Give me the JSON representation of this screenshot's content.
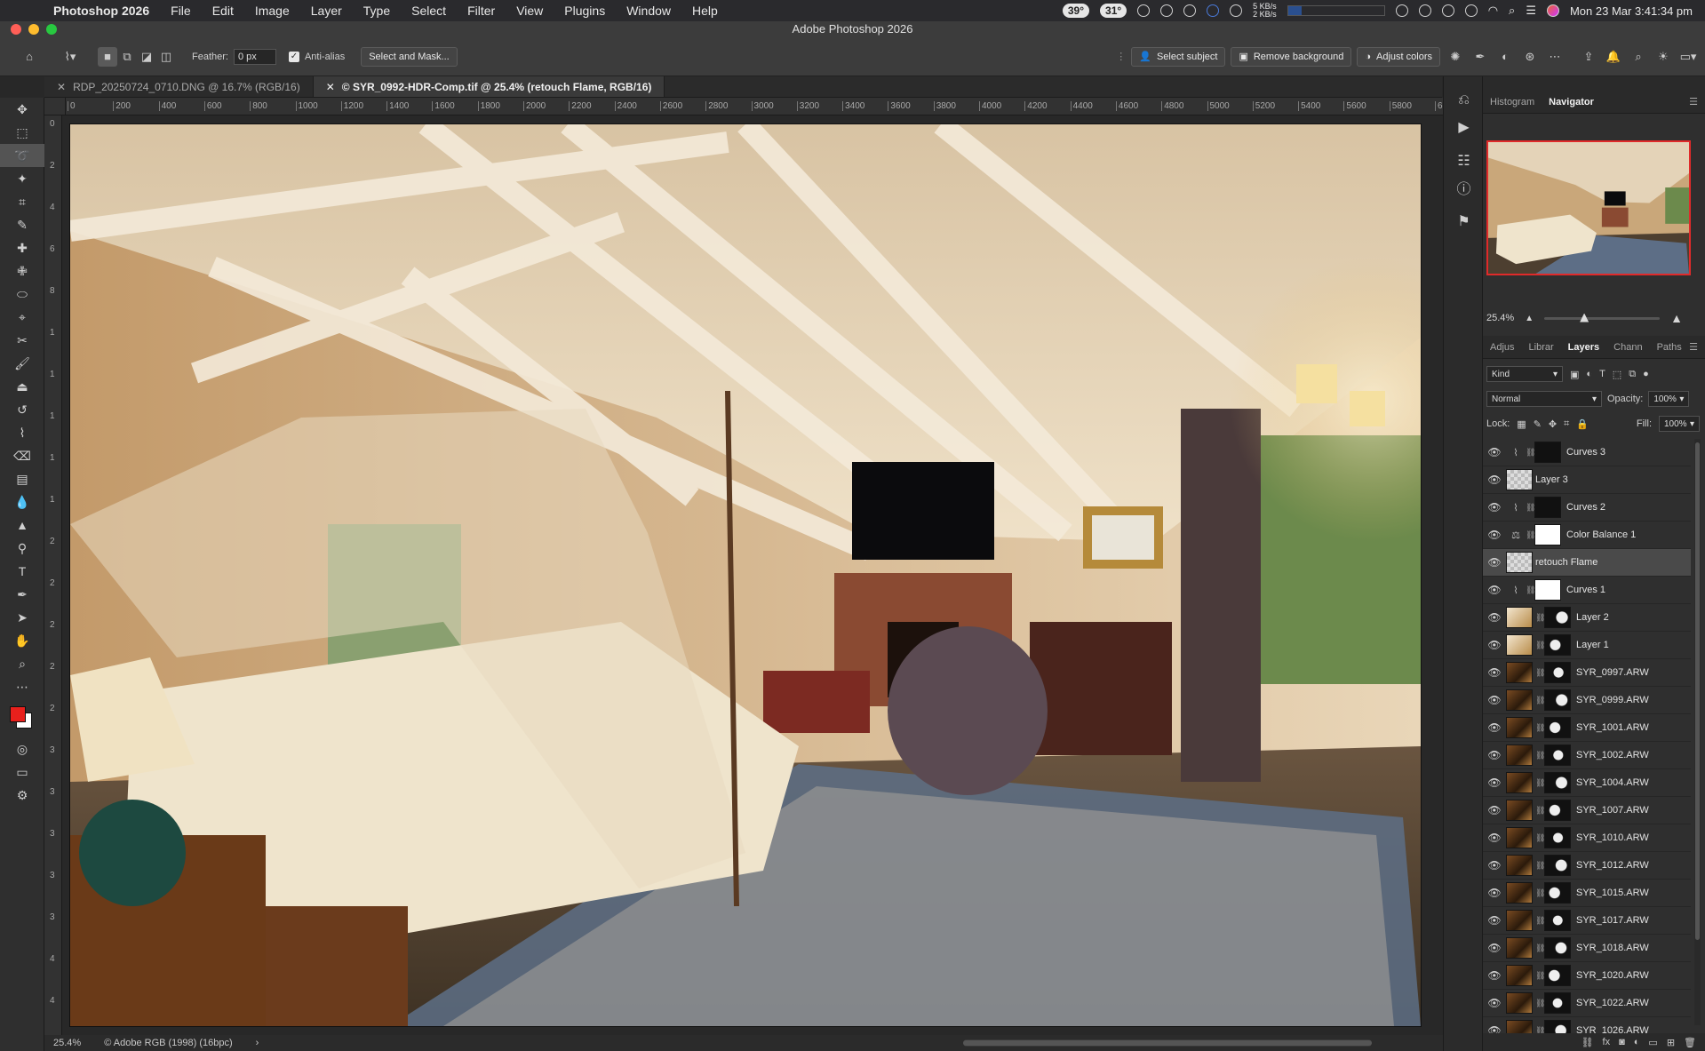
{
  "menubar": {
    "app": "Photoshop 2026",
    "items": [
      "File",
      "Edit",
      "Image",
      "Layer",
      "Type",
      "Select",
      "Filter",
      "View",
      "Plugins",
      "Window",
      "Help"
    ],
    "temp1": "39°",
    "temp2": "31°",
    "net_up": "5 KB/s",
    "net_down": "2 KB/s",
    "datetime": "Mon 23 Mar  3:41:34 pm"
  },
  "window": {
    "title": "Adobe Photoshop 2026"
  },
  "options_bar": {
    "feather_label": "Feather:",
    "feather_value": "0 px",
    "antialias_label": "Anti-alias",
    "select_mask": "Select and Mask...",
    "select_subject": "Select subject",
    "remove_background": "Remove background",
    "adjust_colors": "Adjust colors"
  },
  "tabs": [
    {
      "label": "RDP_20250724_0710.DNG @ 16.7% (RGB/16)"
    },
    {
      "label": "© SYR_0992-HDR-Comp.tif @ 25.4% (retouch Flame, RGB/16)"
    }
  ],
  "ruler": {
    "h": [
      "0",
      "200",
      "400",
      "600",
      "800",
      "1000",
      "1200",
      "1400",
      "1600",
      "1800",
      "2000",
      "2200",
      "2400",
      "2600",
      "2800",
      "3000",
      "3200",
      "3400",
      "3600",
      "3800",
      "4000",
      "4200",
      "4400",
      "4600",
      "4800",
      "5000",
      "5200",
      "5400",
      "5600",
      "5800",
      "6"
    ],
    "v": [
      "0",
      "2",
      "4",
      "6",
      "8",
      "1",
      "1",
      "1",
      "1",
      "1",
      "2",
      "2",
      "2",
      "2",
      "2",
      "3",
      "3",
      "3",
      "3",
      "3",
      "4",
      "4"
    ]
  },
  "status": {
    "zoom": "25.4%",
    "profile": "© Adobe RGB (1998) (16bpc)",
    "arrow": "›"
  },
  "top_panel": {
    "tabs": [
      "Histogram",
      "Navigator"
    ],
    "zoom": "25.4%"
  },
  "layers_panel": {
    "tabs": [
      "Adjus",
      "Librar",
      "Layers",
      "Chann",
      "Paths"
    ],
    "kind": "Kind",
    "blend": "Normal",
    "opacity_label": "Opacity:",
    "opacity": "100%",
    "lock_label": "Lock:",
    "fill_label": "Fill:",
    "fill": "100%",
    "layers": [
      {
        "name": "Curves 3",
        "type": "curves",
        "mask": "black"
      },
      {
        "name": "Layer 3",
        "type": "pixel-empty",
        "mask": ""
      },
      {
        "name": "Curves 2",
        "type": "curves",
        "mask": "black"
      },
      {
        "name": "Color Balance 1",
        "type": "balance",
        "mask": "white"
      },
      {
        "name": "retouch Flame",
        "type": "pixel-empty",
        "mask": "",
        "selected": true
      },
      {
        "name": "Curves 1",
        "type": "curves",
        "mask": "white"
      },
      {
        "name": "Layer 2",
        "type": "pixel",
        "mask": "black"
      },
      {
        "name": "Layer 1",
        "type": "pixel",
        "mask": "black"
      },
      {
        "name": "SYR_0997.ARW",
        "type": "raw",
        "mask": "black"
      },
      {
        "name": "SYR_0999.ARW",
        "type": "raw",
        "mask": "black"
      },
      {
        "name": "SYR_1001.ARW",
        "type": "raw",
        "mask": "black"
      },
      {
        "name": "SYR_1002.ARW",
        "type": "raw",
        "mask": "black"
      },
      {
        "name": "SYR_1004.ARW",
        "type": "raw",
        "mask": "black"
      },
      {
        "name": "SYR_1007.ARW",
        "type": "raw",
        "mask": "black"
      },
      {
        "name": "SYR_1010.ARW",
        "type": "raw",
        "mask": "black"
      },
      {
        "name": "SYR_1012.ARW",
        "type": "raw",
        "mask": "black"
      },
      {
        "name": "SYR_1015.ARW",
        "type": "raw",
        "mask": "black"
      },
      {
        "name": "SYR_1017.ARW",
        "type": "raw",
        "mask": "black"
      },
      {
        "name": "SYR_1018.ARW",
        "type": "raw",
        "mask": "black"
      },
      {
        "name": "SYR_1020.ARW",
        "type": "raw",
        "mask": "black"
      },
      {
        "name": "SYR_1022.ARW",
        "type": "raw",
        "mask": "black"
      },
      {
        "name": "SYR_1026.ARW",
        "type": "raw",
        "mask": "black"
      }
    ]
  },
  "colors": {
    "foreground": "#e8201c",
    "background": "#ffffff",
    "accent": "#e02a2a"
  }
}
